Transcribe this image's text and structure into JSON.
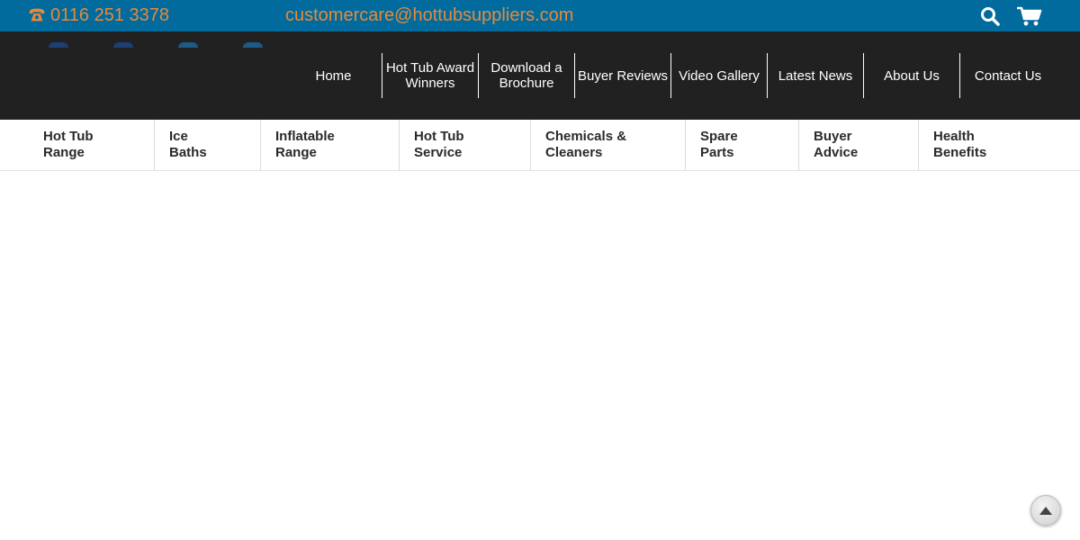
{
  "topbar": {
    "phone": "0116 251 3378",
    "email": "customercare@hottubsuppliers.com",
    "icons": {
      "phone": "phone-icon",
      "search": "search-icon",
      "cart": "cart-icon"
    }
  },
  "main_nav": {
    "items": [
      {
        "label": "Home"
      },
      {
        "label": "Hot Tub Award Winners"
      },
      {
        "label": "Download a Brochure"
      },
      {
        "label": "Buyer Reviews"
      },
      {
        "label": "Video Gallery"
      },
      {
        "label": "Latest News"
      },
      {
        "label": "About Us"
      },
      {
        "label": "Contact Us"
      }
    ]
  },
  "category_nav": {
    "items": [
      {
        "label": "Hot Tub Range"
      },
      {
        "label": "Ice Baths"
      },
      {
        "label": "Inflatable Range"
      },
      {
        "label": "Hot Tub Service"
      },
      {
        "label": "Chemicals & Cleaners"
      },
      {
        "label": "Spare Parts"
      },
      {
        "label": "Buyer Advice"
      },
      {
        "label": "Health Benefits"
      }
    ]
  },
  "back_to_top": {
    "icon": "arrow-up-icon"
  },
  "colors": {
    "topbar_bg": "#006b9c",
    "topbar_text": "#e8893a",
    "header_bg": "#212121",
    "nav_text": "#ffffff",
    "category_text": "#2a2a2a"
  }
}
